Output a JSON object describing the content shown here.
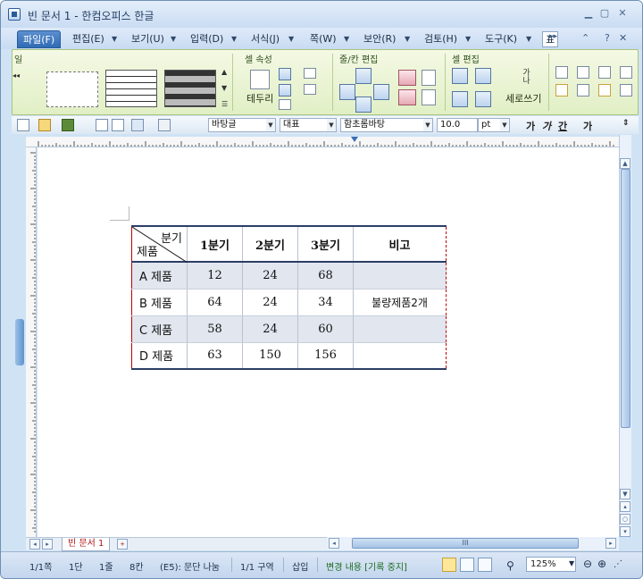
{
  "window": {
    "title": "빈 문서 1 - 한컴오피스 한글"
  },
  "menu": {
    "items": [
      {
        "label": "파일(F)"
      },
      {
        "label": "편집(E)"
      },
      {
        "label": "보기(U)"
      },
      {
        "label": "입력(D)"
      },
      {
        "label": "서식(J)"
      },
      {
        "label": "쪽(W)"
      },
      {
        "label": "보안(R)"
      },
      {
        "label": "검토(H)"
      },
      {
        "label": "도구(K)"
      }
    ],
    "overflow": "표"
  },
  "ribbon": {
    "groups": [
      {
        "title": "셀 속성"
      },
      {
        "title": "줄/칸 편집"
      },
      {
        "title": "셀 편집"
      }
    ],
    "first_group_title": "일",
    "border_label": "테두리",
    "vertical_text_label": "세로쓰기",
    "vertical_icon_text": "가나"
  },
  "toolbar": {
    "style": "바탕글",
    "language": "대표",
    "font": "함초롬바탕",
    "size": "10.0",
    "unit": "pt",
    "bold": "가",
    "italic": "가",
    "underline": "간",
    "more": "가"
  },
  "document": {
    "table": {
      "corner_top": "분기",
      "corner_bottom": "제품",
      "headers": [
        "1분기",
        "2분기",
        "3분기",
        "비고"
      ],
      "rows": [
        {
          "label": "A 제품",
          "values": [
            "12",
            "24",
            "68"
          ],
          "note": ""
        },
        {
          "label": "B 제품",
          "values": [
            "64",
            "24",
            "34"
          ],
          "note": "불량제품2개"
        },
        {
          "label": "C 제품",
          "values": [
            "58",
            "24",
            "60"
          ],
          "note": ""
        },
        {
          "label": "D 제품",
          "values": [
            "63",
            "150",
            "156"
          ],
          "note": ""
        }
      ]
    },
    "tab": "빈 문서 1",
    "hscroll_thumb": "III"
  },
  "status": {
    "page": "1/1쪽",
    "column": "1단",
    "line": "1줄",
    "char": "8칸",
    "cell": "(E5): 문단 나눔",
    "section": "1/1 구역",
    "mode": "삽입",
    "change": "변경 내용 [기록 중지]",
    "zoom": "125%"
  }
}
